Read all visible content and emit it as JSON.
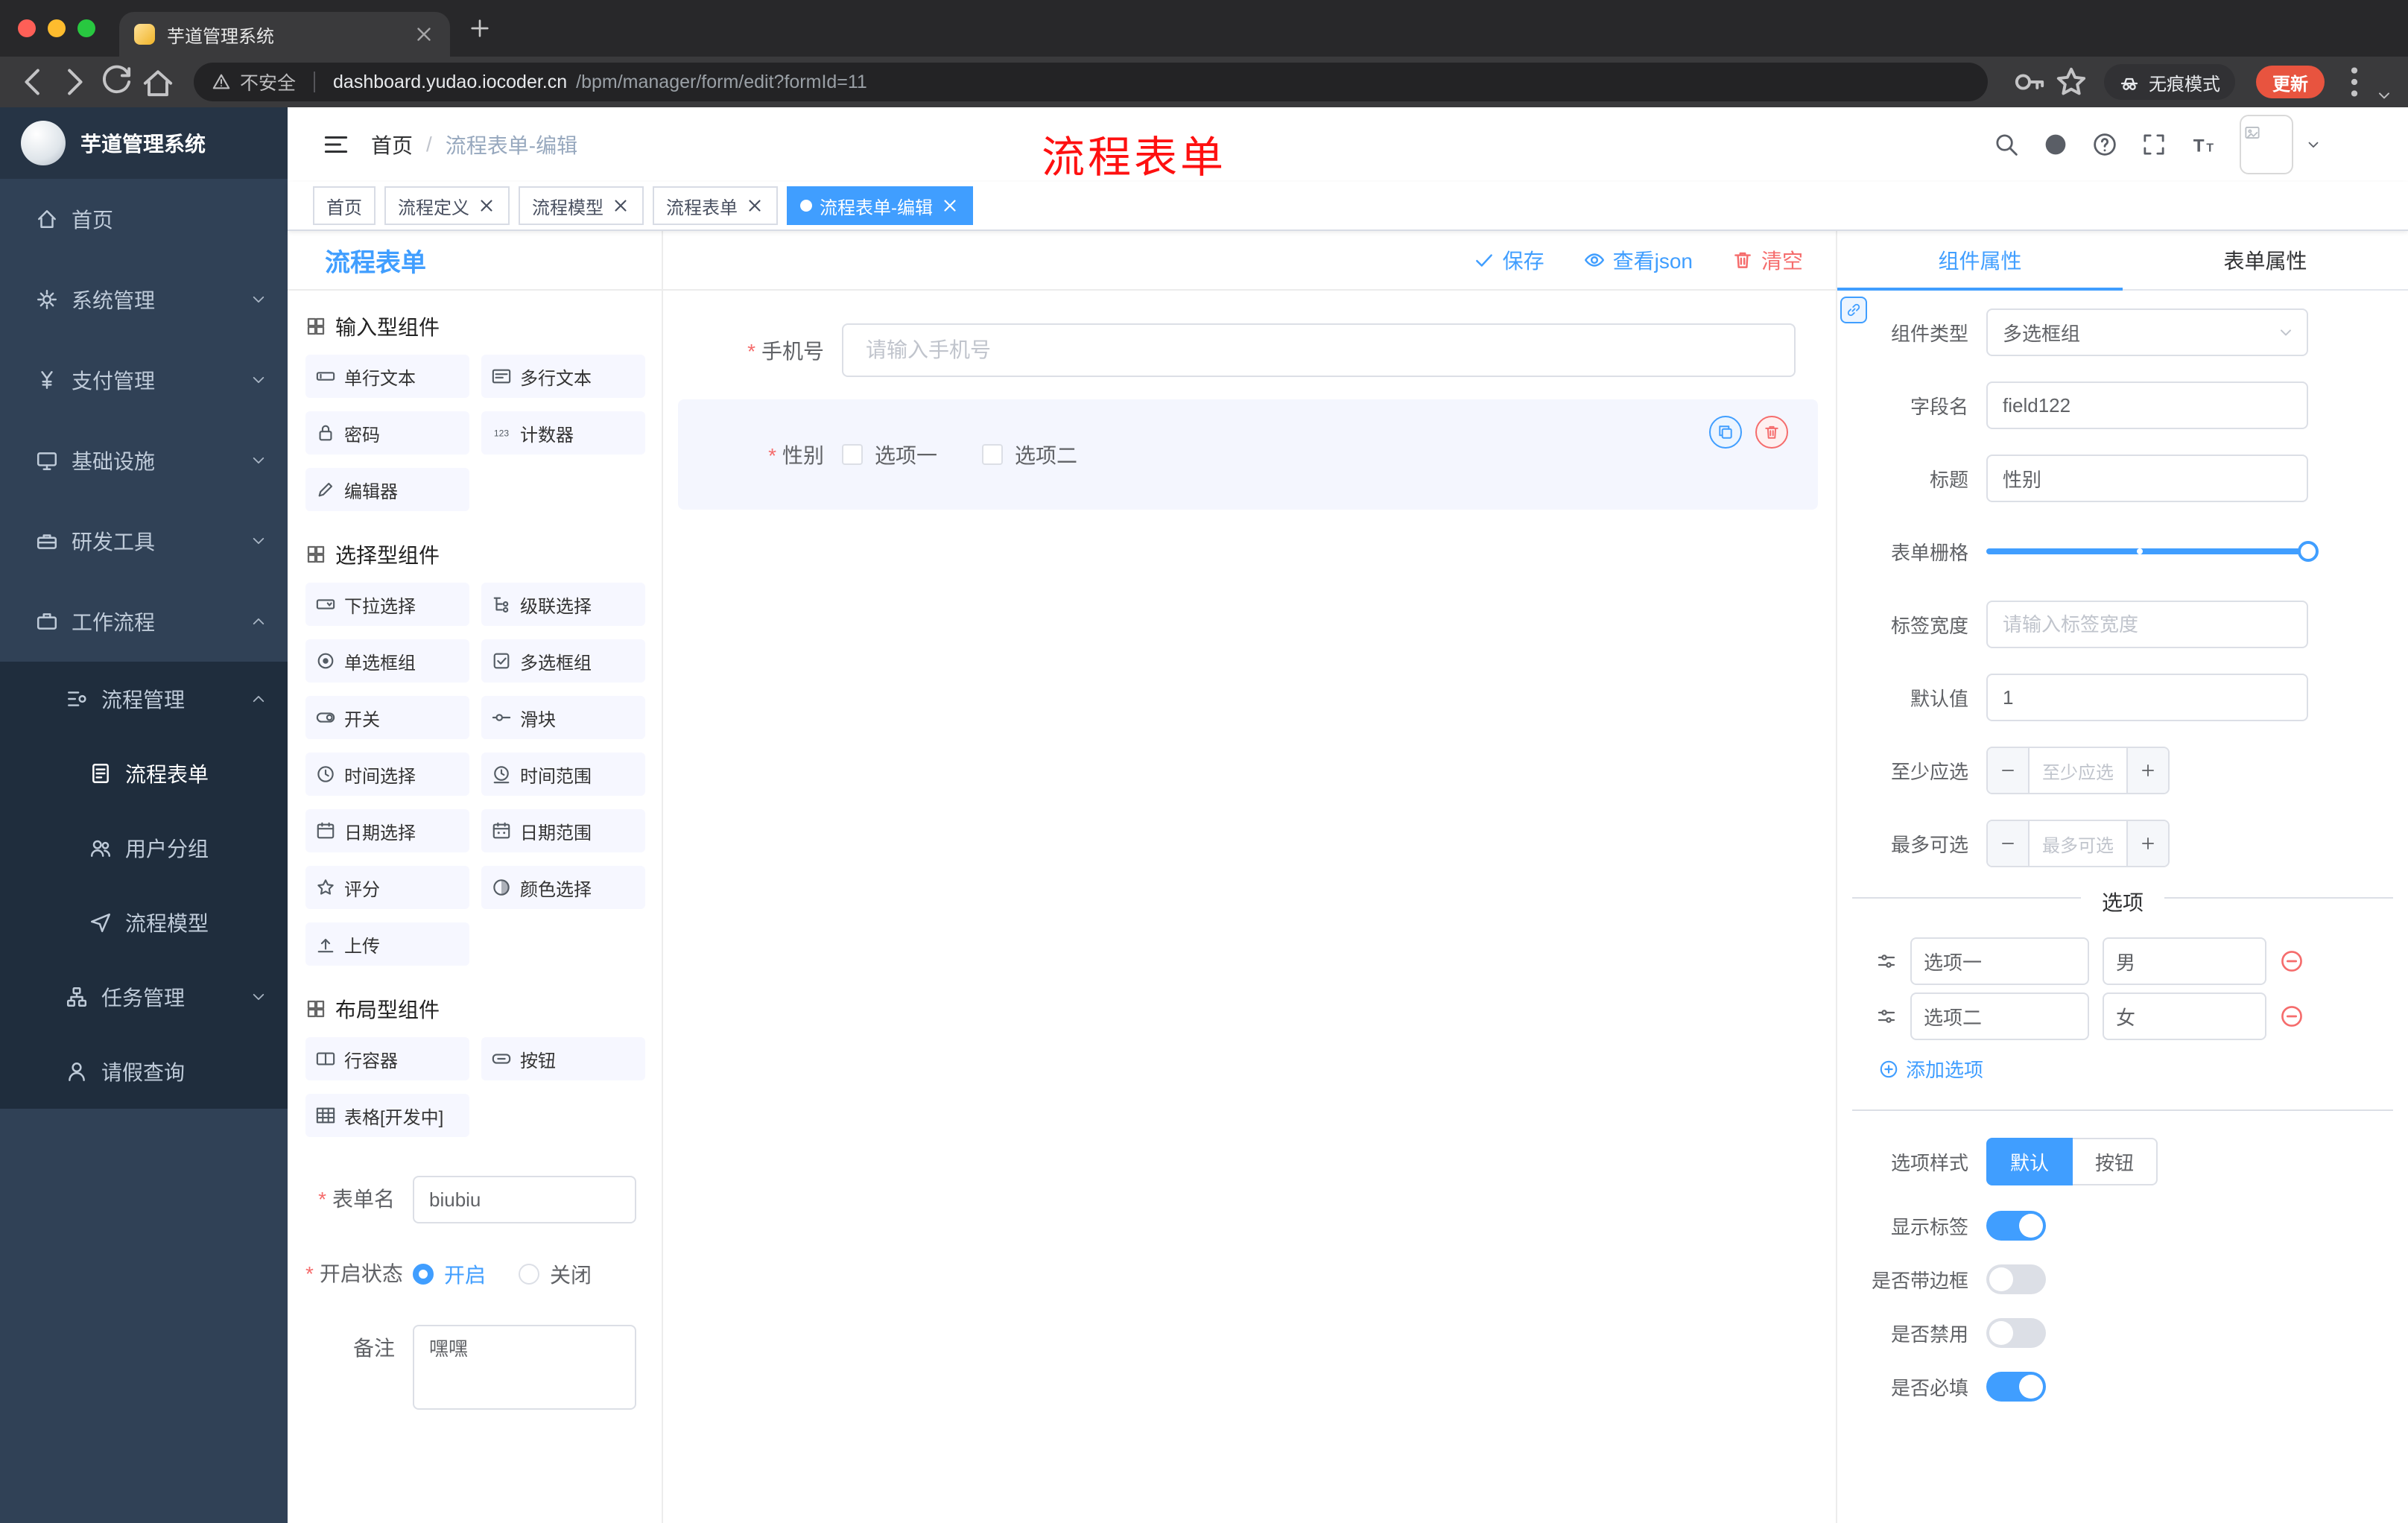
{
  "browser": {
    "tab_title": "芋道管理系统",
    "security_label": "不安全",
    "url_domain": "dashboard.yudao.iocoder.cn",
    "url_path": "/bpm/manager/form/edit?formId=11",
    "incognito_label": "无痕模式",
    "update_label": "更新"
  },
  "sidebar": {
    "app_title": "芋道管理系统",
    "items": [
      {
        "key": "home",
        "label": "首页",
        "icon": "home",
        "level": 1
      },
      {
        "key": "system",
        "label": "系统管理",
        "icon": "gear",
        "level": 1,
        "chevron": "down"
      },
      {
        "key": "payment",
        "label": "支付管理",
        "icon": "yen",
        "level": 1,
        "chevron": "down"
      },
      {
        "key": "infra",
        "label": "基础设施",
        "icon": "monitor",
        "level": 1,
        "chevron": "down"
      },
      {
        "key": "devtools",
        "label": "研发工具",
        "icon": "toolbox",
        "level": 1,
        "chevron": "down"
      },
      {
        "key": "workflow",
        "label": "工作流程",
        "icon": "briefcase",
        "level": 1,
        "chevron": "up"
      },
      {
        "key": "process-mgmt",
        "label": "流程管理",
        "icon": "flow",
        "level": 2,
        "chevron": "up"
      },
      {
        "key": "process-form",
        "label": "流程表单",
        "icon": "doc",
        "level": 3,
        "active": true
      },
      {
        "key": "user-group",
        "label": "用户分组",
        "icon": "users",
        "level": 3
      },
      {
        "key": "process-model",
        "label": "流程模型",
        "icon": "send",
        "level": 3
      },
      {
        "key": "task-mgmt",
        "label": "任务管理",
        "icon": "tasks",
        "level": 2,
        "chevron": "down"
      },
      {
        "key": "leave-query",
        "label": "请假查询",
        "icon": "user",
        "level": 2
      }
    ]
  },
  "header": {
    "breadcrumb_home": "首页",
    "breadcrumb_current": "流程表单-编辑",
    "overlay_title": "流程表单"
  },
  "page_tabs": [
    {
      "key": "home",
      "label": "首页",
      "closable": false,
      "active": false
    },
    {
      "key": "process-definition",
      "label": "流程定义",
      "closable": true,
      "active": false
    },
    {
      "key": "process-model",
      "label": "流程模型",
      "closable": true,
      "active": false
    },
    {
      "key": "process-form",
      "label": "流程表单",
      "closable": true,
      "active": false
    },
    {
      "key": "process-form-edit",
      "label": "流程表单-编辑",
      "closable": true,
      "active": true
    }
  ],
  "designer": {
    "panel_title": "流程表单",
    "actions": {
      "save": "保存",
      "view_json": "查看json",
      "clear": "清空"
    },
    "left": {
      "sections": [
        {
          "title": "输入型组件",
          "items": [
            {
              "key": "single-line",
              "label": "单行文本",
              "icon": "input"
            },
            {
              "key": "multi-line",
              "label": "多行文本",
              "icon": "textarea"
            },
            {
              "key": "password",
              "label": "密码",
              "icon": "lock"
            },
            {
              "key": "counter",
              "label": "计数器",
              "icon": "counter"
            },
            {
              "key": "editor",
              "label": "编辑器",
              "icon": "editor"
            }
          ]
        },
        {
          "title": "选择型组件",
          "items": [
            {
              "key": "select",
              "label": "下拉选择",
              "icon": "select"
            },
            {
              "key": "cascader",
              "label": "级联选择",
              "icon": "cascader"
            },
            {
              "key": "radio-group",
              "label": "单选框组",
              "icon": "radio"
            },
            {
              "key": "checkbox-group",
              "label": "多选框组",
              "icon": "checkbox"
            },
            {
              "key": "switch",
              "label": "开关",
              "icon": "switch"
            },
            {
              "key": "slider",
              "label": "滑块",
              "icon": "slider"
            },
            {
              "key": "time-picker",
              "label": "时间选择",
              "icon": "time"
            },
            {
              "key": "time-range",
              "label": "时间范围",
              "icon": "timerange"
            },
            {
              "key": "date-picker",
              "label": "日期选择",
              "icon": "date"
            },
            {
              "key": "date-range",
              "label": "日期范围",
              "icon": "daterange"
            },
            {
              "key": "rate",
              "label": "评分",
              "icon": "rate"
            },
            {
              "key": "color-picker",
              "label": "颜色选择",
              "icon": "color"
            },
            {
              "key": "upload",
              "label": "上传",
              "icon": "upload"
            }
          ]
        },
        {
          "title": "布局型组件",
          "items": [
            {
              "key": "row-container",
              "label": "行容器",
              "icon": "rowcont"
            },
            {
              "key": "button",
              "label": "按钮",
              "icon": "button"
            },
            {
              "key": "table",
              "label": "表格[开发中]",
              "icon": "table"
            }
          ]
        }
      ],
      "form": {
        "name_label": "表单名",
        "name_value": "biubiu",
        "status_label": "开启状态",
        "status_on": "开启",
        "status_off": "关闭",
        "remark_label": "备注",
        "remark_value": "嘿嘿"
      }
    },
    "canvas": {
      "phone": {
        "label": "手机号",
        "placeholder": "请输入手机号"
      },
      "gender": {
        "label": "性别",
        "options": [
          "选项一",
          "选项二"
        ]
      }
    },
    "props": {
      "tabs": [
        "组件属性",
        "表单属性"
      ],
      "component_type_label": "组件类型",
      "component_type_value": "多选框组",
      "field_name_label": "字段名",
      "field_name_value": "field122",
      "title_label": "标题",
      "title_value": "性别",
      "grid_label": "表单栅格",
      "label_width_label": "标签宽度",
      "label_width_placeholder": "请输入标签宽度",
      "default_label": "默认值",
      "default_value": "1",
      "min_label": "至少应选",
      "min_placeholder": "至少应选",
      "max_label": "最多可选",
      "max_placeholder": "最多可选",
      "options_title": "选项",
      "options": [
        {
          "label": "选项一",
          "value": "男"
        },
        {
          "label": "选项二",
          "value": "女"
        }
      ],
      "add_option": "添加选项",
      "style_label": "选项样式",
      "style_default": "默认",
      "style_button": "按钮",
      "toggles": [
        {
          "key": "show-label",
          "label": "显示标签",
          "on": true
        },
        {
          "key": "border",
          "label": "是否带边框",
          "on": false
        },
        {
          "key": "disabled",
          "label": "是否禁用",
          "on": false
        },
        {
          "key": "required",
          "label": "是否必填",
          "on": true
        }
      ]
    }
  },
  "colors": {
    "accent": "#409eff",
    "danger": "#f56c6c",
    "sidebar": "#304156"
  }
}
